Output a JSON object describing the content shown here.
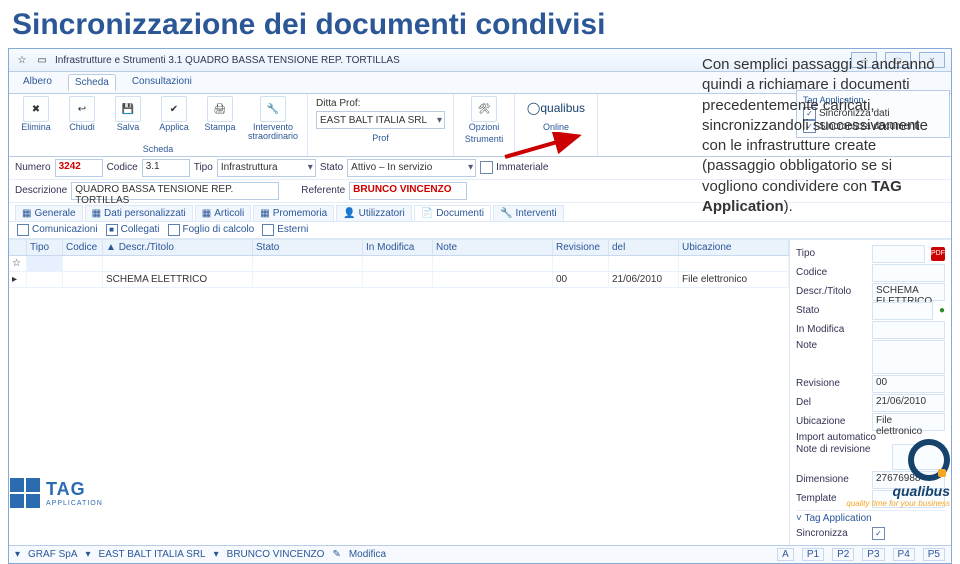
{
  "slide_title": "Sincronizzazione dei documenti condivisi",
  "window": {
    "path": "Infrastrutture e Strumenti 3.1 QUADRO BASSA TENSIONE REP. TORTILLAS"
  },
  "ribbon_tabs": {
    "t1": "Albero",
    "t2": "Scheda",
    "t3": "Consultazioni"
  },
  "ribbon": {
    "scheda": "Scheda",
    "elimina": "Elimina",
    "chiudi": "Chiudi",
    "salva": "Salva",
    "applica": "Applica",
    "stampa": "Stampa",
    "intervento": "Intervento straordinario",
    "ditta_label": "Ditta Prof:",
    "ditta_value": "EAST BALT ITALIA SRL",
    "prof": "Prof",
    "opzioni": "Opzioni",
    "strumenti": "Strumenti",
    "online": "Online",
    "qualibus": "qualibus"
  },
  "form": {
    "numero_l": "Numero",
    "numero_v": "3242",
    "codice_l": "Codice",
    "codice_v": "3.1",
    "tipo_l": "Tipo",
    "tipo_v": "Infrastruttura",
    "stato_l": "Stato",
    "stato_v": "Attivo – In servizio",
    "immateriale_l": "Immateriale",
    "descr_l": "Descrizione",
    "descr_v": "QUADRO BASSA TENSIONE REP. TORTILLAS",
    "ref_l": "Referente",
    "ref_v": "BRUNCO VINCENZO"
  },
  "tagapp": {
    "hdr": "Tag Application",
    "c1": "Sincronizza dati",
    "c2": "Sincronizza documenti"
  },
  "tabs2": {
    "generale": "Generale",
    "dati": "Dati personalizzati",
    "articoli": "Articoli",
    "promemoria": "Promemoria",
    "utilizzatori": "Utilizzatori",
    "documenti": "Documenti",
    "interventi": "Interventi"
  },
  "subtabs": {
    "comunicazioni": "Comunicazioni",
    "collegati": "Collegati",
    "foglio": "Foglio di calcolo",
    "esterni": "Esterni"
  },
  "grid": {
    "h": {
      "tipo": "Tipo",
      "codice": "Codice",
      "descr": "Descr./Titolo",
      "stato": "Stato",
      "inmod": "In Modifica",
      "note": "Note",
      "rev": "Revisione",
      "del": "del",
      "ubic": "Ubicazione"
    },
    "r1": {
      "descr": "SCHEMA ELETTRICO",
      "rev": "00",
      "del": "21/06/2010",
      "ubic": "File elettronico"
    }
  },
  "right": {
    "tipo_l": "Tipo",
    "codice_l": "Codice",
    "descr_l": "Descr./Titolo",
    "descr_v": "SCHEMA ELETTRICO",
    "stato_l": "Stato",
    "inmod_l": "In Modifica",
    "note_l": "Note",
    "revisione_l": "Revisione",
    "revisione_v": "00",
    "del_l": "Del",
    "del_v": "21/06/2010",
    "ubic_l": "Ubicazione",
    "ubic_v": "File elettronico",
    "import_l": "Import automatico",
    "notediv_l": "Note di revisione",
    "dim_l": "Dimensione",
    "dim_v": "27676988",
    "template_l": "Template",
    "tagapp_l": "Tag Application",
    "sincro_l": "Sincronizza"
  },
  "status": {
    "s1": "GRAF SpA",
    "s2": "EAST BALT ITALIA SRL",
    "s3": "BRUNCO VINCENZO",
    "s4": "Modifica",
    "a": "A",
    "p1": "P1",
    "p2": "P2",
    "p3": "P3",
    "p4": "P4",
    "p5": "P5"
  },
  "desc": {
    "p1": "Con semplici passaggi si andranno quindi a richiamare i documenti precedentemente caricati, sincronizzandoli successivamente con le infrastrutture create (passaggio obbligatorio se si vogliono condividere con ",
    "p2": "TAG Application",
    "p3": ")."
  },
  "logos": {
    "tag": "TAG",
    "tag_sub": "APPLICATION",
    "q": "qualibus",
    "q_sub": "quality time for your business"
  }
}
